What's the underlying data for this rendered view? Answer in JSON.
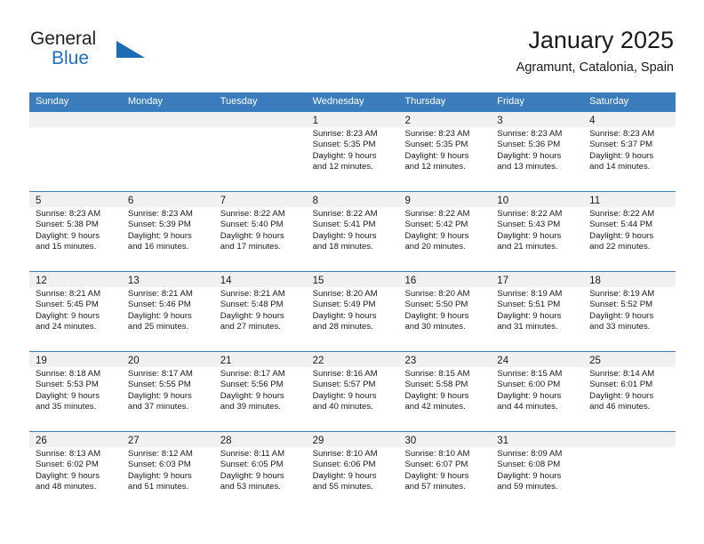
{
  "logo": {
    "word1": "General",
    "word2": "Blue",
    "triangle_color": "#1b6cb5",
    "icon": "triangle-icon"
  },
  "header": {
    "title": "January 2025",
    "subtitle": "Agramunt, Catalonia, Spain"
  },
  "colors": {
    "header_blue": "#3b7cbd",
    "day_band_gray": "#f1f1f1",
    "text": "#1a1a1a",
    "logo_blue": "#1f6fc4"
  },
  "calendar": {
    "weekdays": [
      "Sunday",
      "Monday",
      "Tuesday",
      "Wednesday",
      "Thursday",
      "Friday",
      "Saturday"
    ],
    "weeks": [
      [
        {
          "day": "",
          "sunrise": "",
          "sunset": "",
          "daylight1": "",
          "daylight2": ""
        },
        {
          "day": "",
          "sunrise": "",
          "sunset": "",
          "daylight1": "",
          "daylight2": ""
        },
        {
          "day": "",
          "sunrise": "",
          "sunset": "",
          "daylight1": "",
          "daylight2": ""
        },
        {
          "day": "1",
          "sunrise": "Sunrise: 8:23 AM",
          "sunset": "Sunset: 5:35 PM",
          "daylight1": "Daylight: 9 hours",
          "daylight2": "and 12 minutes."
        },
        {
          "day": "2",
          "sunrise": "Sunrise: 8:23 AM",
          "sunset": "Sunset: 5:35 PM",
          "daylight1": "Daylight: 9 hours",
          "daylight2": "and 12 minutes."
        },
        {
          "day": "3",
          "sunrise": "Sunrise: 8:23 AM",
          "sunset": "Sunset: 5:36 PM",
          "daylight1": "Daylight: 9 hours",
          "daylight2": "and 13 minutes."
        },
        {
          "day": "4",
          "sunrise": "Sunrise: 8:23 AM",
          "sunset": "Sunset: 5:37 PM",
          "daylight1": "Daylight: 9 hours",
          "daylight2": "and 14 minutes."
        }
      ],
      [
        {
          "day": "5",
          "sunrise": "Sunrise: 8:23 AM",
          "sunset": "Sunset: 5:38 PM",
          "daylight1": "Daylight: 9 hours",
          "daylight2": "and 15 minutes."
        },
        {
          "day": "6",
          "sunrise": "Sunrise: 8:23 AM",
          "sunset": "Sunset: 5:39 PM",
          "daylight1": "Daylight: 9 hours",
          "daylight2": "and 16 minutes."
        },
        {
          "day": "7",
          "sunrise": "Sunrise: 8:22 AM",
          "sunset": "Sunset: 5:40 PM",
          "daylight1": "Daylight: 9 hours",
          "daylight2": "and 17 minutes."
        },
        {
          "day": "8",
          "sunrise": "Sunrise: 8:22 AM",
          "sunset": "Sunset: 5:41 PM",
          "daylight1": "Daylight: 9 hours",
          "daylight2": "and 18 minutes."
        },
        {
          "day": "9",
          "sunrise": "Sunrise: 8:22 AM",
          "sunset": "Sunset: 5:42 PM",
          "daylight1": "Daylight: 9 hours",
          "daylight2": "and 20 minutes."
        },
        {
          "day": "10",
          "sunrise": "Sunrise: 8:22 AM",
          "sunset": "Sunset: 5:43 PM",
          "daylight1": "Daylight: 9 hours",
          "daylight2": "and 21 minutes."
        },
        {
          "day": "11",
          "sunrise": "Sunrise: 8:22 AM",
          "sunset": "Sunset: 5:44 PM",
          "daylight1": "Daylight: 9 hours",
          "daylight2": "and 22 minutes."
        }
      ],
      [
        {
          "day": "12",
          "sunrise": "Sunrise: 8:21 AM",
          "sunset": "Sunset: 5:45 PM",
          "daylight1": "Daylight: 9 hours",
          "daylight2": "and 24 minutes."
        },
        {
          "day": "13",
          "sunrise": "Sunrise: 8:21 AM",
          "sunset": "Sunset: 5:46 PM",
          "daylight1": "Daylight: 9 hours",
          "daylight2": "and 25 minutes."
        },
        {
          "day": "14",
          "sunrise": "Sunrise: 8:21 AM",
          "sunset": "Sunset: 5:48 PM",
          "daylight1": "Daylight: 9 hours",
          "daylight2": "and 27 minutes."
        },
        {
          "day": "15",
          "sunrise": "Sunrise: 8:20 AM",
          "sunset": "Sunset: 5:49 PM",
          "daylight1": "Daylight: 9 hours",
          "daylight2": "and 28 minutes."
        },
        {
          "day": "16",
          "sunrise": "Sunrise: 8:20 AM",
          "sunset": "Sunset: 5:50 PM",
          "daylight1": "Daylight: 9 hours",
          "daylight2": "and 30 minutes."
        },
        {
          "day": "17",
          "sunrise": "Sunrise: 8:19 AM",
          "sunset": "Sunset: 5:51 PM",
          "daylight1": "Daylight: 9 hours",
          "daylight2": "and 31 minutes."
        },
        {
          "day": "18",
          "sunrise": "Sunrise: 8:19 AM",
          "sunset": "Sunset: 5:52 PM",
          "daylight1": "Daylight: 9 hours",
          "daylight2": "and 33 minutes."
        }
      ],
      [
        {
          "day": "19",
          "sunrise": "Sunrise: 8:18 AM",
          "sunset": "Sunset: 5:53 PM",
          "daylight1": "Daylight: 9 hours",
          "daylight2": "and 35 minutes."
        },
        {
          "day": "20",
          "sunrise": "Sunrise: 8:17 AM",
          "sunset": "Sunset: 5:55 PM",
          "daylight1": "Daylight: 9 hours",
          "daylight2": "and 37 minutes."
        },
        {
          "day": "21",
          "sunrise": "Sunrise: 8:17 AM",
          "sunset": "Sunset: 5:56 PM",
          "daylight1": "Daylight: 9 hours",
          "daylight2": "and 39 minutes."
        },
        {
          "day": "22",
          "sunrise": "Sunrise: 8:16 AM",
          "sunset": "Sunset: 5:57 PM",
          "daylight1": "Daylight: 9 hours",
          "daylight2": "and 40 minutes."
        },
        {
          "day": "23",
          "sunrise": "Sunrise: 8:15 AM",
          "sunset": "Sunset: 5:58 PM",
          "daylight1": "Daylight: 9 hours",
          "daylight2": "and 42 minutes."
        },
        {
          "day": "24",
          "sunrise": "Sunrise: 8:15 AM",
          "sunset": "Sunset: 6:00 PM",
          "daylight1": "Daylight: 9 hours",
          "daylight2": "and 44 minutes."
        },
        {
          "day": "25",
          "sunrise": "Sunrise: 8:14 AM",
          "sunset": "Sunset: 6:01 PM",
          "daylight1": "Daylight: 9 hours",
          "daylight2": "and 46 minutes."
        }
      ],
      [
        {
          "day": "26",
          "sunrise": "Sunrise: 8:13 AM",
          "sunset": "Sunset: 6:02 PM",
          "daylight1": "Daylight: 9 hours",
          "daylight2": "and 48 minutes."
        },
        {
          "day": "27",
          "sunrise": "Sunrise: 8:12 AM",
          "sunset": "Sunset: 6:03 PM",
          "daylight1": "Daylight: 9 hours",
          "daylight2": "and 51 minutes."
        },
        {
          "day": "28",
          "sunrise": "Sunrise: 8:11 AM",
          "sunset": "Sunset: 6:05 PM",
          "daylight1": "Daylight: 9 hours",
          "daylight2": "and 53 minutes."
        },
        {
          "day": "29",
          "sunrise": "Sunrise: 8:10 AM",
          "sunset": "Sunset: 6:06 PM",
          "daylight1": "Daylight: 9 hours",
          "daylight2": "and 55 minutes."
        },
        {
          "day": "30",
          "sunrise": "Sunrise: 8:10 AM",
          "sunset": "Sunset: 6:07 PM",
          "daylight1": "Daylight: 9 hours",
          "daylight2": "and 57 minutes."
        },
        {
          "day": "31",
          "sunrise": "Sunrise: 8:09 AM",
          "sunset": "Sunset: 6:08 PM",
          "daylight1": "Daylight: 9 hours",
          "daylight2": "and 59 minutes."
        },
        {
          "day": "",
          "sunrise": "",
          "sunset": "",
          "daylight1": "",
          "daylight2": ""
        }
      ]
    ]
  }
}
